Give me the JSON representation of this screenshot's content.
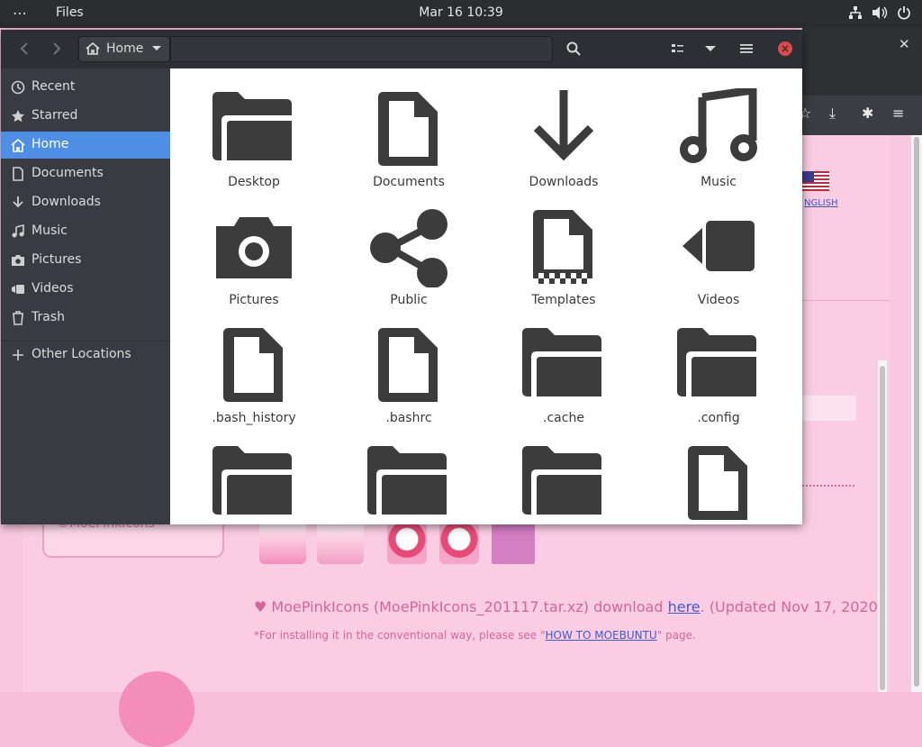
{
  "topbar": {
    "menu_icon": "dots-icon",
    "app_name": "Files",
    "clock": "Mar 16  10:39",
    "system_icons": [
      "network-icon",
      "volume-icon",
      "power-icon"
    ]
  },
  "files_window": {
    "path_label": "Home",
    "sidebar": {
      "items": [
        {
          "label": "Recent",
          "icon": "clock-icon"
        },
        {
          "label": "Starred",
          "icon": "star-icon"
        },
        {
          "label": "Home",
          "icon": "home-icon",
          "active": true
        },
        {
          "label": "Documents",
          "icon": "document-icon"
        },
        {
          "label": "Downloads",
          "icon": "download-icon"
        },
        {
          "label": "Music",
          "icon": "music-icon"
        },
        {
          "label": "Pictures",
          "icon": "camera-icon"
        },
        {
          "label": "Videos",
          "icon": "video-icon"
        },
        {
          "label": "Trash",
          "icon": "trash-icon"
        }
      ],
      "other_locations": "Other Locations"
    },
    "items": [
      {
        "name": "Desktop",
        "icon": "folder"
      },
      {
        "name": "Documents",
        "icon": "file"
      },
      {
        "name": "Downloads",
        "icon": "download"
      },
      {
        "name": "Music",
        "icon": "music"
      },
      {
        "name": "Pictures",
        "icon": "camera"
      },
      {
        "name": "Public",
        "icon": "share"
      },
      {
        "name": "Templates",
        "icon": "template"
      },
      {
        "name": "Videos",
        "icon": "video"
      },
      {
        "name": ".bash_history",
        "icon": "file"
      },
      {
        "name": ".bashrc",
        "icon": "file"
      },
      {
        "name": ".cache",
        "icon": "folder"
      },
      {
        "name": ".config",
        "icon": "folder"
      },
      {
        "name": "",
        "icon": "folder"
      },
      {
        "name": "",
        "icon": "folder"
      },
      {
        "name": "",
        "icon": "folder"
      },
      {
        "name": "",
        "icon": "file"
      }
    ]
  },
  "browser_page": {
    "language_link": "NGLISH",
    "credit": "©MoePinkIcons",
    "download_line_prefix": "♥ MoePinkIcons (MoePinkIcons_201117.tar.xz) download ",
    "download_link": "here",
    "download_line_suffix": ". (Updated Nov 17, 2020)",
    "install_prefix": "*For installing it in the conventional way, please see \"",
    "install_link": "HOW TO MOEBUNTU",
    "install_suffix": "\" page."
  },
  "colors": {
    "accent": "#4e8fe5",
    "topbar": "#2b2e31",
    "sidebar": "#383b41",
    "page_pink": "#fbcde2",
    "close_red": "#e04a4a"
  }
}
